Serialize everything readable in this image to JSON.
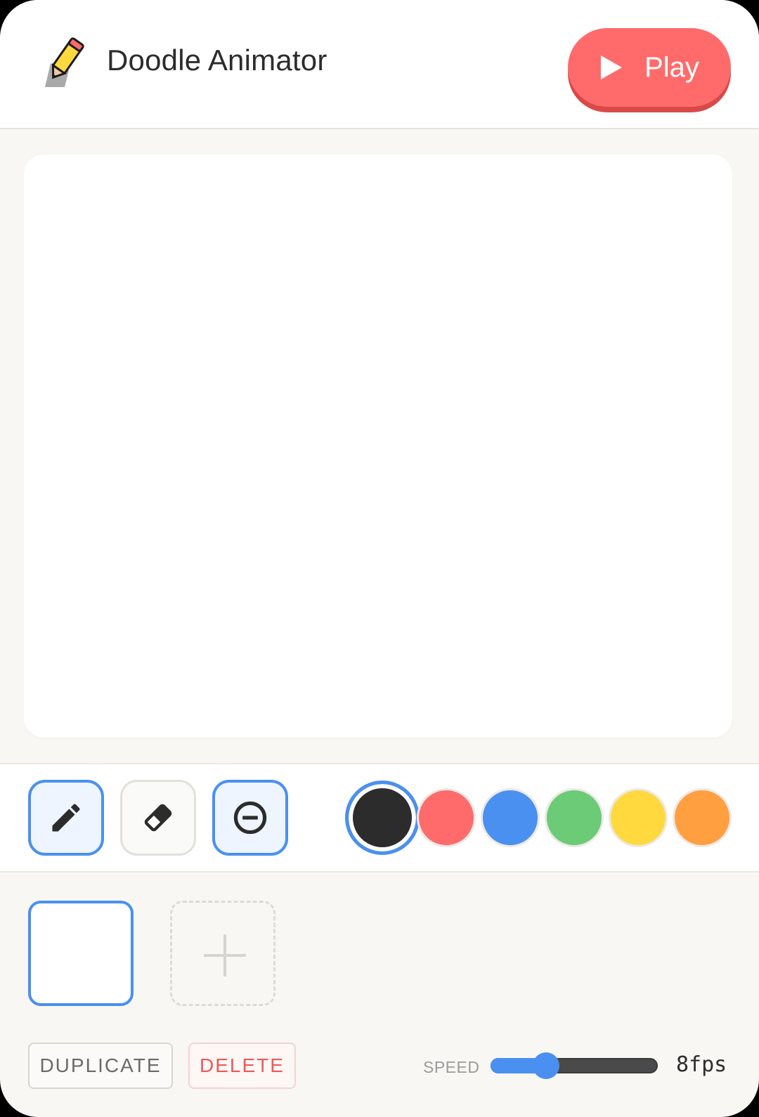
{
  "header": {
    "title": "Doodle Animator",
    "logo_icon": "pencil-icon",
    "play_label": "Play",
    "play_color": "#ff6b6b"
  },
  "tools": [
    {
      "name": "pen",
      "icon": "pencil-icon",
      "active": true
    },
    {
      "name": "eraser",
      "icon": "eraser-icon",
      "active": false
    },
    {
      "name": "clear",
      "icon": "minus-circle-icon",
      "active": true
    }
  ],
  "colors": {
    "selected": "#2c2c2c",
    "palette": [
      "#2c2c2c",
      "#ff6b6b",
      "#4a90f0",
      "#6bcb77",
      "#ffd93d",
      "#ff9f40"
    ]
  },
  "frames": {
    "count": 1,
    "current": 1
  },
  "actions": {
    "duplicate_label": "DUPLICATE",
    "delete_label": "DELETE"
  },
  "speed": {
    "label": "SPEED",
    "value_text": "8fps",
    "fraction": 0.33
  }
}
